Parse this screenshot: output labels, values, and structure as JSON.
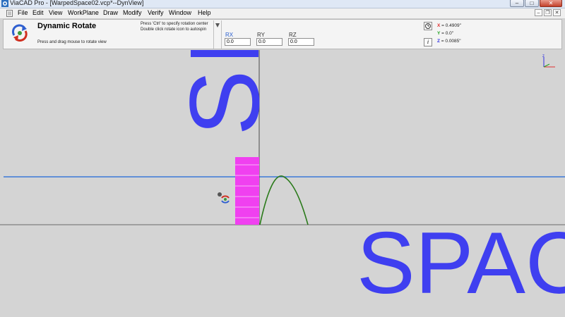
{
  "window": {
    "title": "ViaCAD Pro - [WarpedSpace02.vcp*--DynView]",
    "controls": [
      "minimize",
      "maximize",
      "close"
    ]
  },
  "menubar": {
    "items": [
      "File",
      "Edit",
      "View",
      "WorkPlane",
      "Draw",
      "Modify",
      "Verify",
      "Window",
      "Help"
    ],
    "mdi_controls": [
      "minimize",
      "restore",
      "close"
    ]
  },
  "tool_panel": {
    "title": "Dynamic Rotate",
    "instruction": "Press and drag mouse to rotate view",
    "hint_line1": "Press 'Ctrl' to specify rotation center",
    "hint_line2": "Double click rotate icon to autospin",
    "fields": [
      {
        "label": "RX",
        "value": "0.0"
      },
      {
        "label": "RY",
        "value": "0.0"
      },
      {
        "label": "RZ",
        "value": "0.0"
      }
    ]
  },
  "coordinates": {
    "x_label": "X",
    "x_value": "= 0.4909\"",
    "y_label": "Y",
    "y_value": "= 0.0\"",
    "z_label": "Z",
    "z_value": "= 0.0085\""
  },
  "viewport": {
    "text_vertical": "S",
    "text_horizontal": "SPAC",
    "triad_z": "z"
  },
  "colors": {
    "text_blue": "#3f3ff0",
    "magenta_block": "#f040f0",
    "curve_green": "#2a7a1a",
    "workplane_line": "#3b78d8",
    "x_axis": "#e03030",
    "y_axis": "#20a020",
    "z_axis": "#3030e0"
  },
  "icons": {
    "app": "viacad-app-icon",
    "doc": "document-icon",
    "tool": "dynamic-rotate-icon",
    "cursor": "rotate-cursor-icon",
    "triad": "axis-triad-icon"
  }
}
